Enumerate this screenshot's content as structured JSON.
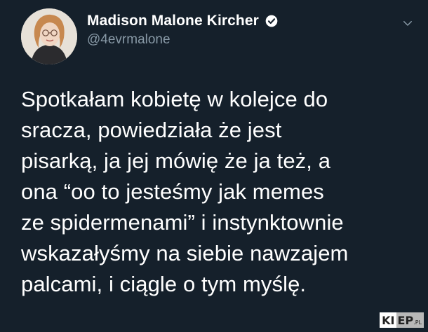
{
  "author": {
    "display_name": "Madison Malone Kircher",
    "handle": "@4evrmalone",
    "verified_icon": "verified-badge-icon",
    "avatar_icon": "profile-photo"
  },
  "menu": {
    "icon": "chevron-down-icon"
  },
  "tweet": {
    "text": "Spotkałam kobietę w kolejce do\nsracza, powiedziała że jest\npisarką, ja jej mówię że ja też, a\nona “oo to jesteśmy jak memes\nze spidermenami” i instynktownie\nwskazałyśmy na siebie nawzajem\npalcami, i ciągle o tym myślę."
  },
  "watermark": {
    "part1": "KI",
    "part2": "EP",
    "suffix": ".PL"
  },
  "colors": {
    "background": "#15202b",
    "text": "#ffffff",
    "secondary": "#8899a6"
  }
}
